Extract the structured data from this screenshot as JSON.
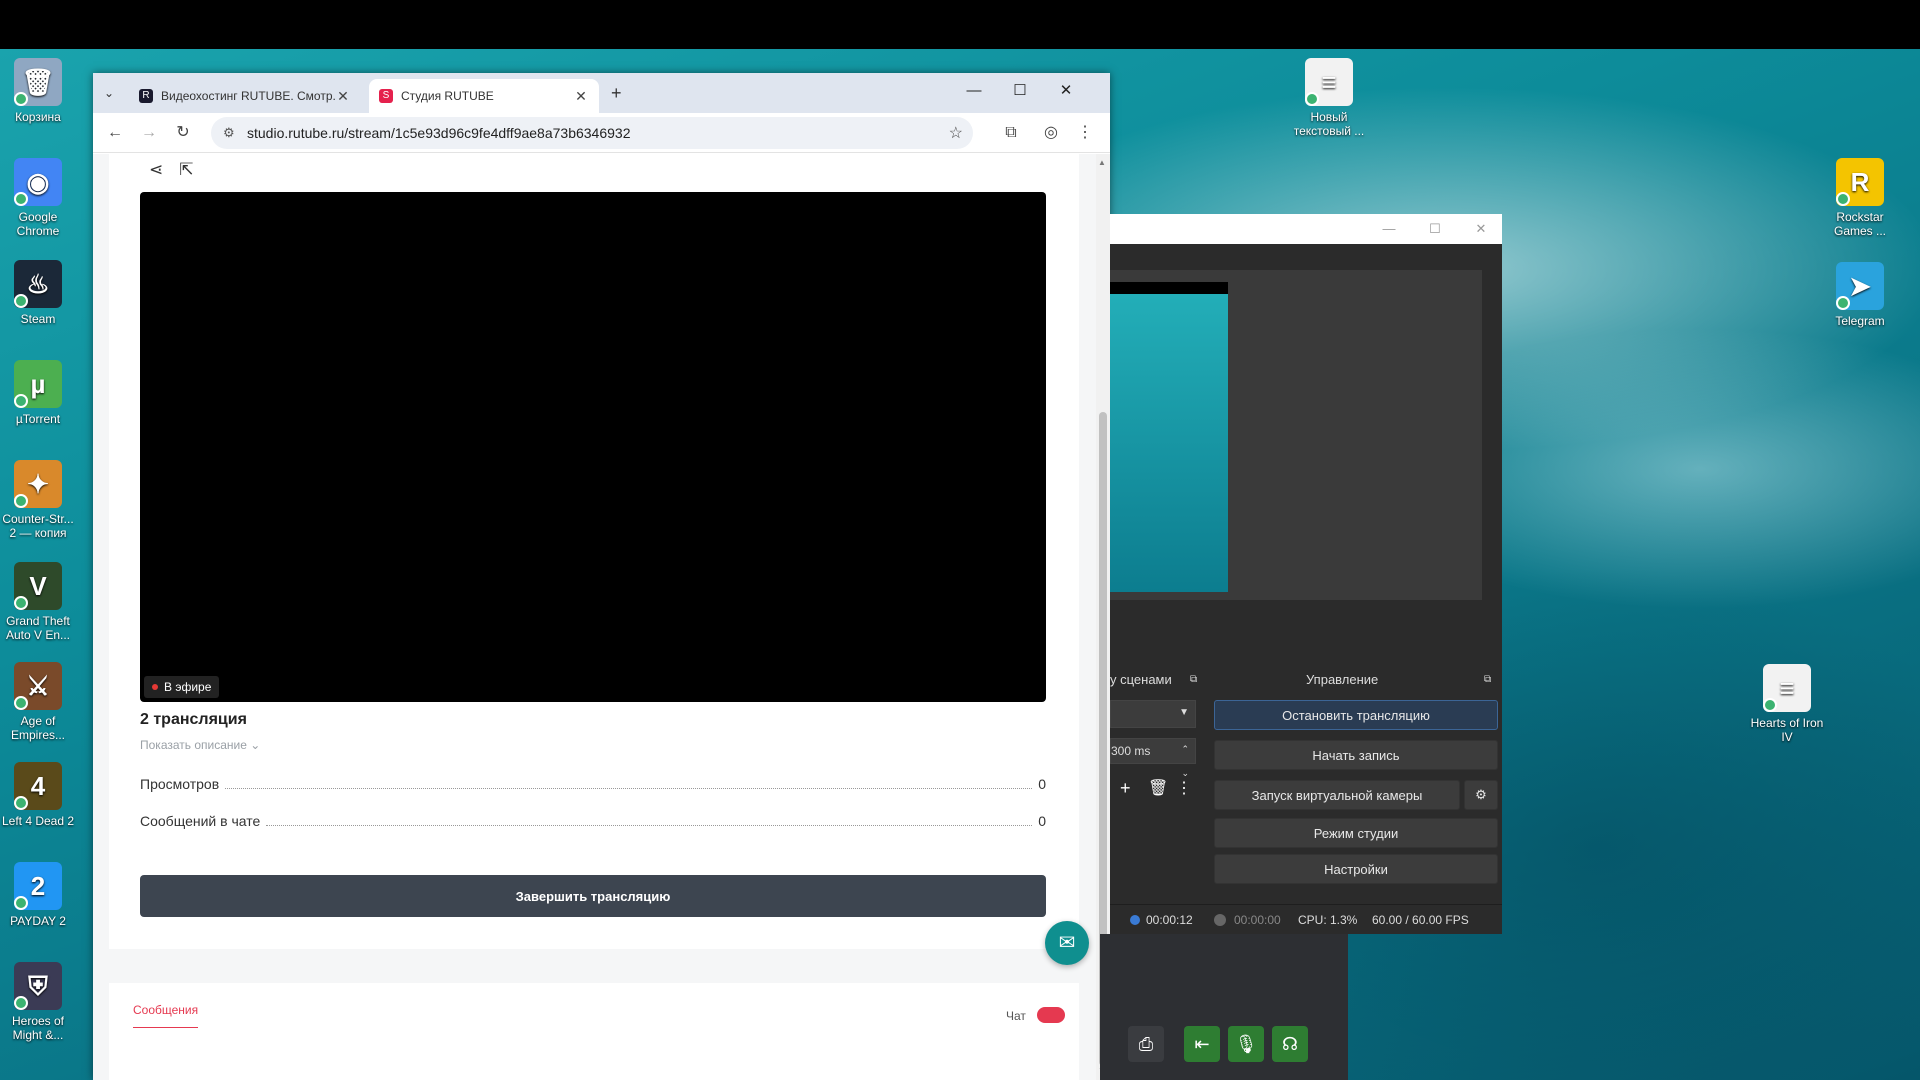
{
  "desktop": {
    "left_icons": [
      {
        "label": "Корзина",
        "color": "#8fa7c2",
        "glyph": "🗑"
      },
      {
        "label": "Google Chrome",
        "color": "#4285f4",
        "glyph": "◉"
      },
      {
        "label": "Steam",
        "color": "#1b2838",
        "glyph": "♨"
      },
      {
        "label": "µTorrent",
        "color": "#4caf50",
        "glyph": "µ"
      },
      {
        "label": "Counter-Str... 2 — копия",
        "color": "#d9892b",
        "glyph": "✦"
      },
      {
        "label": "Grand Theft Auto V En...",
        "color": "#2e4a2a",
        "glyph": "V"
      },
      {
        "label": "Age of Empires...",
        "color": "#7a4a2a",
        "glyph": "⚔"
      },
      {
        "label": "Left 4 Dead 2",
        "color": "#5a4a1a",
        "glyph": "4"
      },
      {
        "label": "PAYDAY 2",
        "color": "#2196f3",
        "glyph": "2"
      },
      {
        "label": "Heroes of Might &...",
        "color": "#3b3b55",
        "glyph": "⛨"
      }
    ],
    "right_icons": [
      {
        "label": "Новый текстовый ...",
        "color": "#f2f2f2",
        "glyph": "≡"
      },
      {
        "label": "Rockstar Games ...",
        "color": "#f4c400",
        "glyph": "R"
      },
      {
        "label": "Telegram",
        "color": "#2aa3dd",
        "glyph": "➤"
      },
      {
        "label": "Hearts of Iron IV",
        "color": "#f2f2f2",
        "glyph": "≡"
      }
    ]
  },
  "browser": {
    "tabs": [
      {
        "title": "Видеохостинг RUTUBE. Смотр...",
        "fav_color": "#1a1a2e",
        "fav_letter": "R"
      },
      {
        "title": "Студия RUTUBE",
        "fav_color": "#e5214d",
        "fav_letter": "S"
      }
    ],
    "url": "studio.rutube.ru/stream/1c5e93d96c9fe4dff9ae8a73b6346932",
    "page": {
      "live_label": "В эфире",
      "stream_title": "2 трансляция",
      "show_description": "Показать описание ⌄",
      "stats": [
        {
          "label": "Просмотров",
          "value": "0"
        },
        {
          "label": "Сообщений в чате",
          "value": "0"
        }
      ],
      "end_button": "Завершить трансляцию",
      "messages_tab": "Сообщения",
      "chat_label": "Чат"
    }
  },
  "obs": {
    "scenes_header_fragment": "у сценами",
    "controls_header": "Управление",
    "duration_value": "300 ms",
    "buttons": {
      "stop_stream": "Остановить трансляцию",
      "start_recording": "Начать запись",
      "virtual_camera": "Запуск виртуальной камеры",
      "studio_mode": "Режим студии",
      "settings": "Настройки"
    },
    "status": {
      "stream_time": "00:00:12",
      "record_time": "00:00:00",
      "cpu": "CPU: 1.3%",
      "fps": "60.00 / 60.00 FPS"
    },
    "colors": {
      "stream_dot": "#3a7bd5",
      "record_dot": "#666666"
    }
  }
}
